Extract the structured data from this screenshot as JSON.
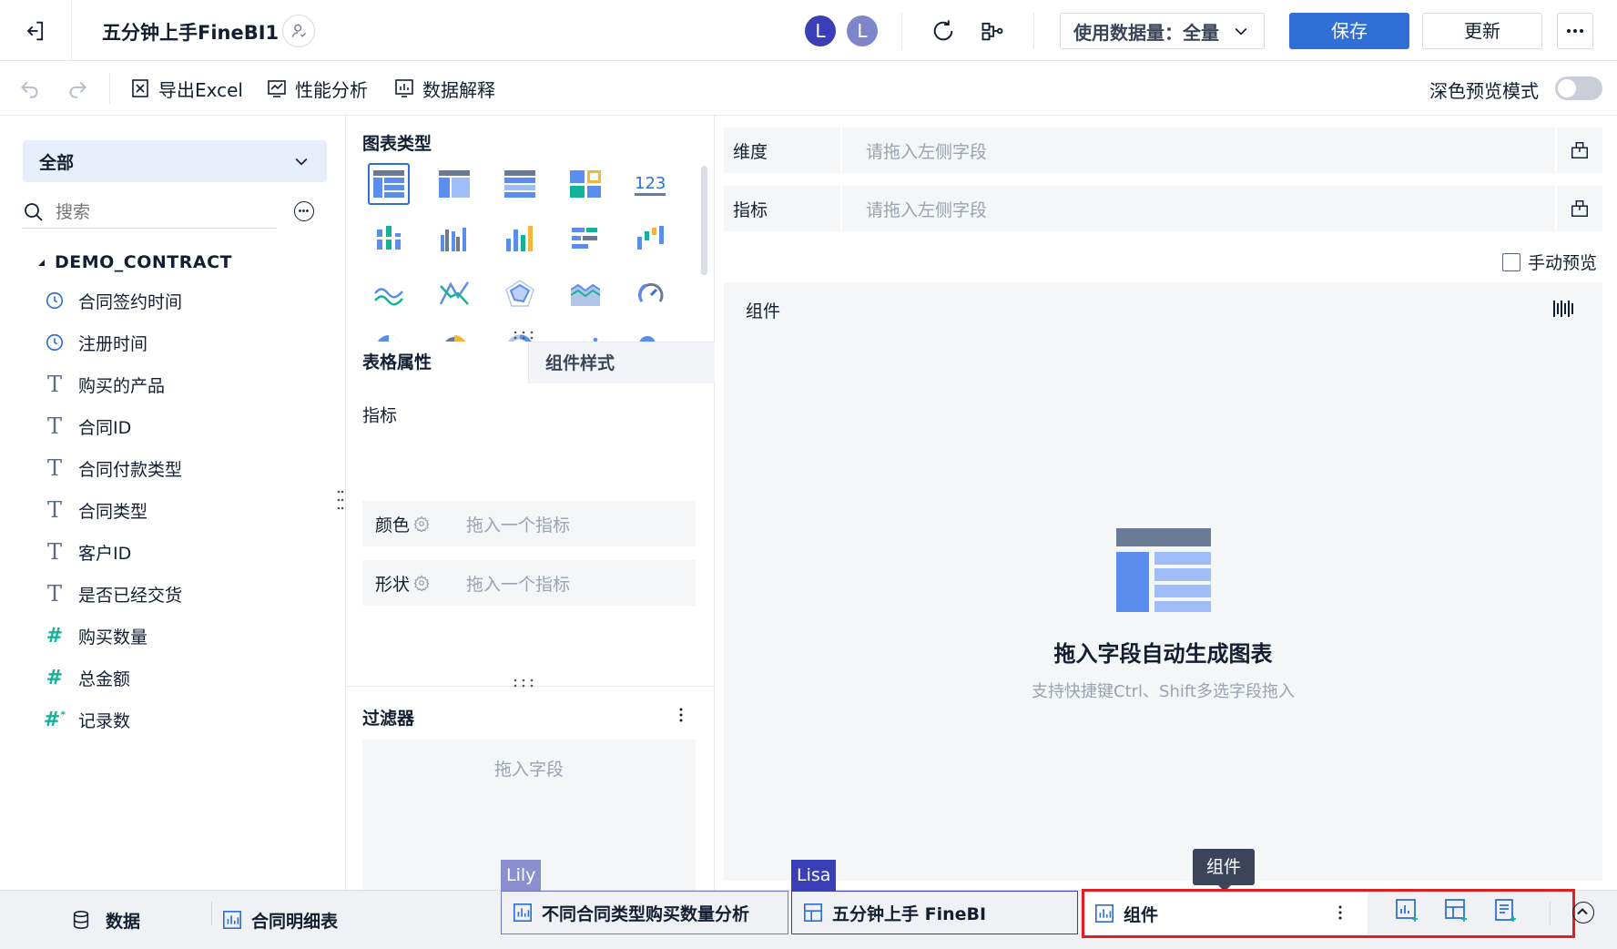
{
  "header": {
    "title": "五分钟上手FineBI1",
    "avatars": [
      "L",
      "L"
    ],
    "data_amount_label": "使用数据量：全量",
    "save_label": "保存",
    "update_label": "更新"
  },
  "toolbar": {
    "export_label": "导出Excel",
    "performance_label": "性能分析",
    "explain_label": "数据解释",
    "dark_preview_label": "深色预览模式"
  },
  "left": {
    "scope_select": "全部",
    "search_placeholder": "搜索",
    "table_name": "DEMO_CONTRACT",
    "fields": [
      {
        "label": "合同签约时间",
        "type": "time"
      },
      {
        "label": "注册时间",
        "type": "time"
      },
      {
        "label": "购买的产品",
        "type": "text"
      },
      {
        "label": "合同ID",
        "type": "text"
      },
      {
        "label": "合同付款类型",
        "type": "text"
      },
      {
        "label": "合同类型",
        "type": "text"
      },
      {
        "label": "客户ID",
        "type": "text"
      },
      {
        "label": "是否已经交货",
        "type": "text"
      },
      {
        "label": "购买数量",
        "type": "number"
      },
      {
        "label": "总金额",
        "type": "number"
      },
      {
        "label": "记录数",
        "type": "number-record"
      }
    ]
  },
  "middle": {
    "chart_type_title": "图表类型",
    "tab_table_props": "表格属性",
    "tab_component_style": "组件样式",
    "indicator_label": "指标",
    "color_label": "颜色",
    "shape_label": "形状",
    "drop_indicator_placeholder": "拖入一个指标",
    "filter_title": "过滤器",
    "drop_field_placeholder": "拖入字段"
  },
  "right": {
    "dimension_label": "维度",
    "measure_label": "指标",
    "drop_left_field_placeholder": "请拖入左侧字段",
    "manual_preview_label": "手动预览",
    "component_title": "组件",
    "empty_title": "拖入字段自动生成图表",
    "empty_hint": "支持快捷键Ctrl、Shift多选字段拖入"
  },
  "bottom": {
    "data_tab": "数据",
    "tabs": [
      "合同明细表",
      "不同合同类型购买数量分析",
      "五分钟上手 FineBI",
      "组件"
    ],
    "user_tag_1": "Lily",
    "user_tag_2": "Lisa",
    "tooltip": "组件"
  },
  "colors": {
    "primary": "#2f6fd6",
    "avatar1": "#3a3fb8",
    "avatar2": "#7e86c9",
    "teal": "#13b39a",
    "highlight_red": "#e02020"
  }
}
